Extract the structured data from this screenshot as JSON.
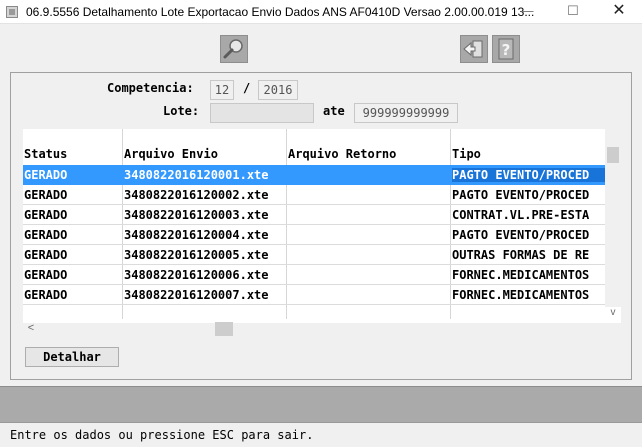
{
  "window": {
    "title": "06.9.5556 Detalhamento Lote Exportacao Envio Dados ANS AF0410D Versao 2.00.00.019 13...",
    "minimize_glyph": "—",
    "maximize_glyph": "☐",
    "close_glyph": "✕"
  },
  "toolbar": {
    "icons": [
      "search-icon",
      "exit-icon",
      "help-icon"
    ]
  },
  "form": {
    "competencia_label": "Competencia:",
    "competencia_month": "12",
    "competencia_sep": "/",
    "competencia_year": "2016",
    "lote_label": "Lote:",
    "lote_start": "",
    "ate_label": "ate",
    "lote_end": "999999999999"
  },
  "grid": {
    "columns": [
      "Status",
      "Arquivo Envio",
      "Arquivo Retorno",
      "Tipo"
    ],
    "rows": [
      [
        "GERADO",
        "3480822016120001.xte",
        "",
        "PAGTO EVENTO/PROCED"
      ],
      [
        "GERADO",
        "3480822016120002.xte",
        "",
        "PAGTO EVENTO/PROCED"
      ],
      [
        "GERADO",
        "3480822016120003.xte",
        "",
        "CONTRAT.VL.PRE-ESTA"
      ],
      [
        "GERADO",
        "3480822016120004.xte",
        "",
        "PAGTO EVENTO/PROCED"
      ],
      [
        "GERADO",
        "3480822016120005.xte",
        "",
        "OUTRAS FORMAS DE RE"
      ],
      [
        "GERADO",
        "3480822016120006.xte",
        "",
        "FORNEC.MEDICAMENTOS"
      ],
      [
        "GERADO",
        "3480822016120007.xte",
        "",
        "FORNEC.MEDICAMENTOS"
      ]
    ],
    "selected_row": 0,
    "scroll_left_glyph": "<",
    "scroll_down_glyph": "v",
    "selection_color": "#3399ff"
  },
  "buttons": {
    "detalhar_label": "Detalhar"
  },
  "status": {
    "message": "Entre os dados ou pressione ESC para sair."
  }
}
